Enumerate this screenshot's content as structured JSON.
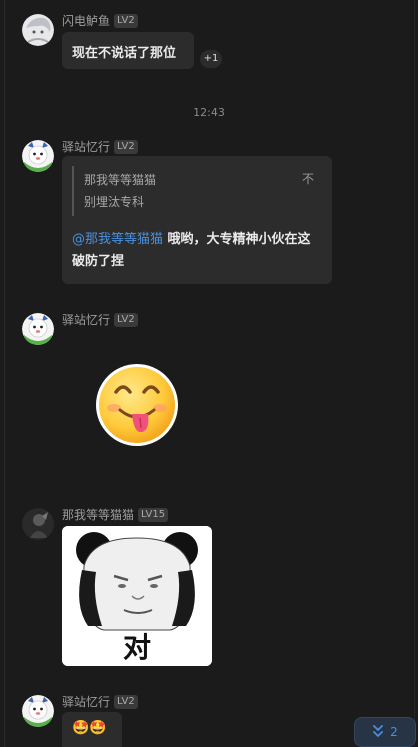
{
  "messages": {
    "m1": {
      "name": "闪电鲈鱼",
      "level": "LV2",
      "text": "现在不说话了那位",
      "reaction": "+1"
    },
    "time": "12:43",
    "m2": {
      "name": "驿站忆行",
      "level": "LV2",
      "quote_name": "那我等等猫猫",
      "quote_text": "别埋汰专科",
      "quote_close": "不",
      "mention": "@那我等等猫猫",
      "text": " 哦哟，大专精神小伙在这破防了捏"
    },
    "m3": {
      "name": "驿站忆行",
      "level": "LV2"
    },
    "m4": {
      "name": "那我等等猫猫",
      "level": "LV15",
      "sticker_text": "对"
    },
    "m5": {
      "name": "驿站忆行",
      "level": "LV2",
      "text": "🤩🤩"
    }
  },
  "scroll_button": {
    "count": "2"
  },
  "colors": {
    "background": "#1b1b1b",
    "bubble": "#2c2c2c",
    "mention": "#4a8fe0"
  }
}
